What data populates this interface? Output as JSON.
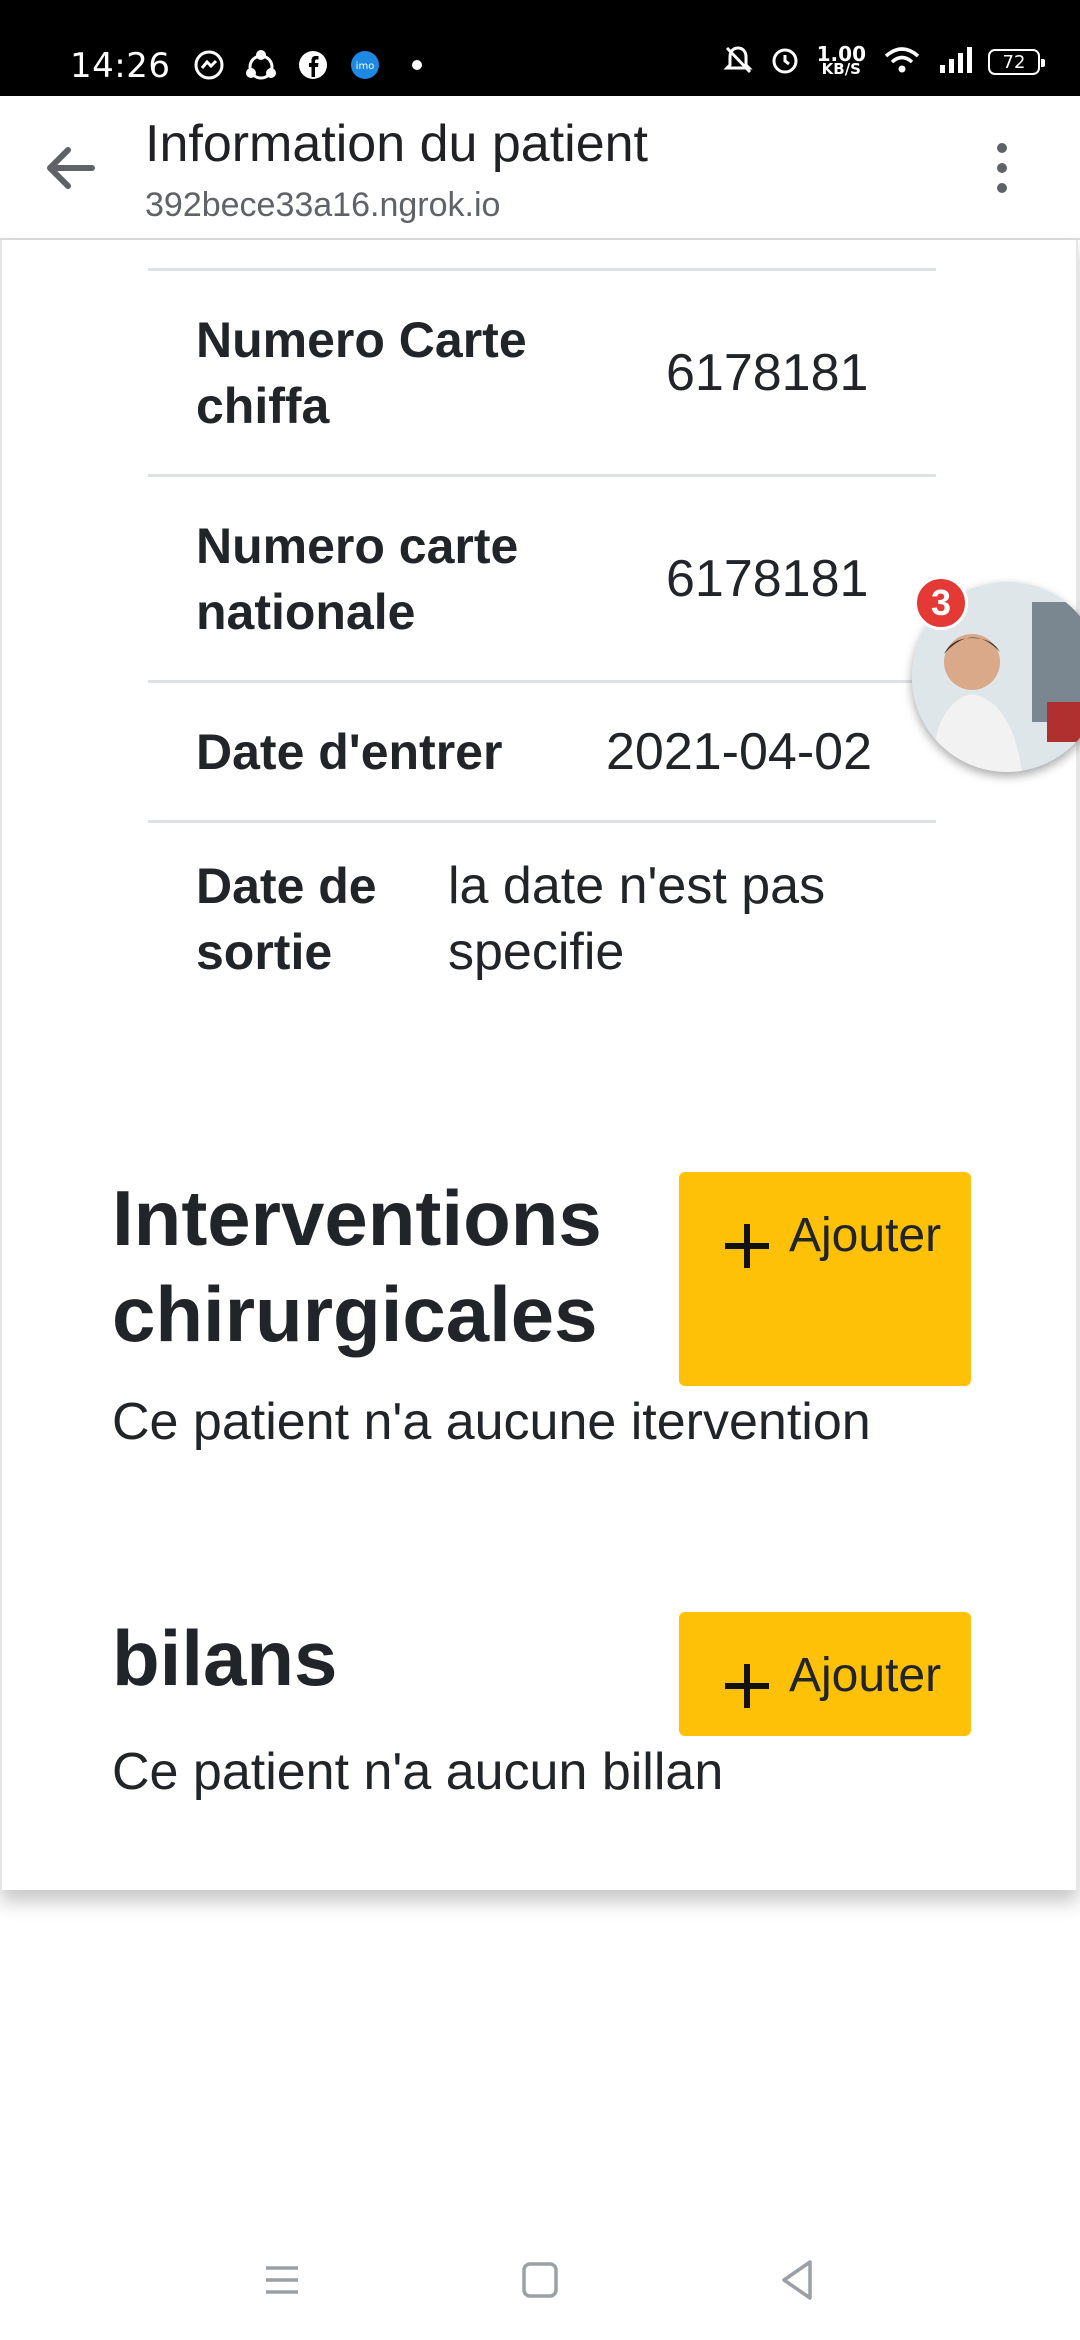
{
  "status_bar": {
    "time": "14:26",
    "speed_value": "1.00",
    "speed_unit": "KB/S",
    "battery": "72"
  },
  "app_bar": {
    "title": "Information du patient",
    "url": "392bece33a16.ngrok.io"
  },
  "patient_table": [
    {
      "label": "Numero Carte chiffa",
      "value": "6178181"
    },
    {
      "label": "Numero carte nationale",
      "value": "6178181"
    },
    {
      "label": "Date d'entrer",
      "value": "2021-04-02"
    },
    {
      "label": "Date de sortie",
      "value": "la date n'est pas specifie"
    }
  ],
  "interventions": {
    "title": "Interventions chirurgicales",
    "add_label": "Ajouter",
    "empty_text": "Ce patient n'a aucune itervention"
  },
  "bilans": {
    "title": "bilans",
    "add_label": "Ajouter",
    "empty_text": "Ce patient n'a aucun billan"
  },
  "chat_bubble": {
    "badge_count": "3"
  },
  "colors": {
    "accent_button": "#ffc107",
    "badge": "#e53935"
  }
}
